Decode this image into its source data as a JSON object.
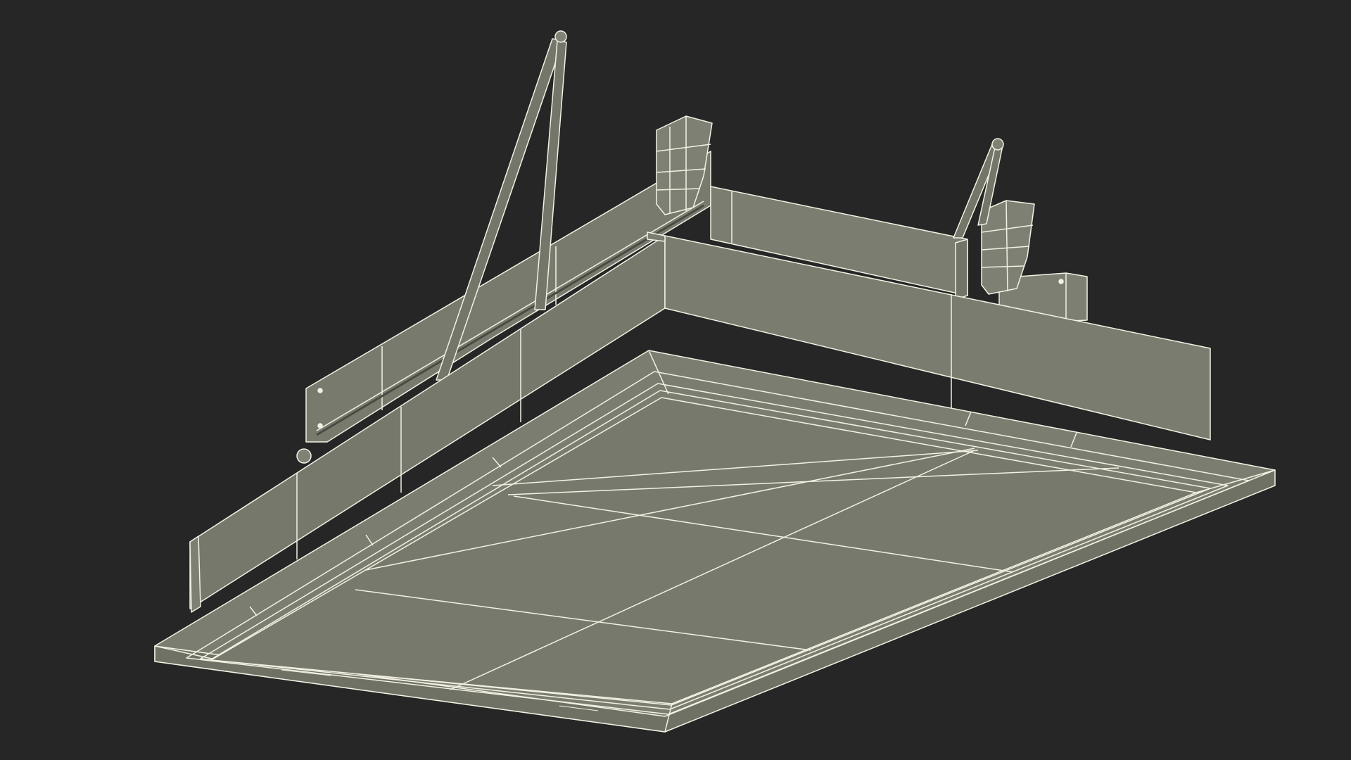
{
  "scene": {
    "subject": "ceiling-hatch-wireframe-render",
    "colors": {
      "background": "#262626",
      "surface_light": "#7c7e71",
      "surface_mid": "#76786b",
      "surface_dark": "#6e7064",
      "wire": "#f2f1e4"
    }
  }
}
